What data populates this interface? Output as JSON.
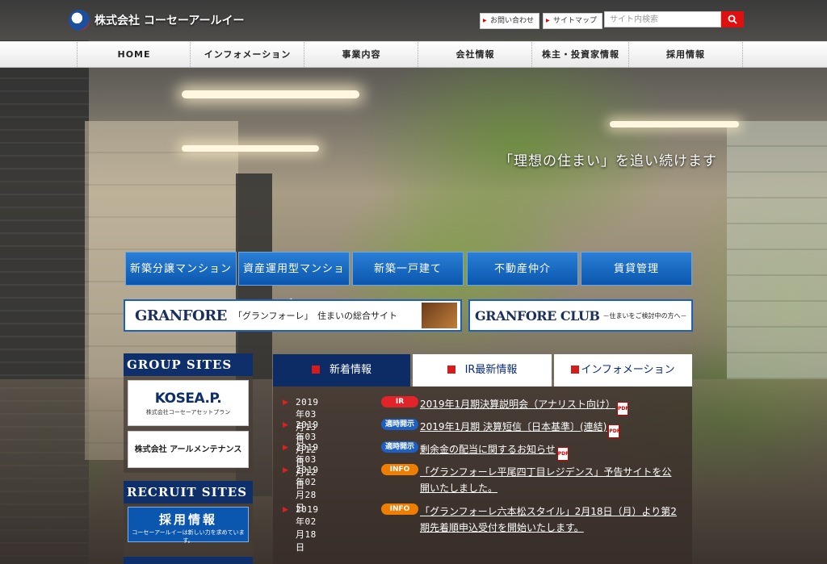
{
  "header": {
    "logo_text": "株式会社 コーセーアールイー",
    "contact_label": "お問い合わせ",
    "sitemap_label": "サイトマップ",
    "search_placeholder": "サイト内検索"
  },
  "nav": [
    "HOME",
    "インフォメーション",
    "事業内容",
    "会社情報",
    "株主・投資家情報",
    "採用情報"
  ],
  "hero": {
    "tagline": "「理想の住まい」を追い続けます"
  },
  "categories": [
    "新築分譲マンション",
    "資産運用型マンション",
    "新築一戸建て",
    "不動産仲介",
    "賃貸管理"
  ],
  "banners": {
    "granfore": {
      "brand": "GRANFORE",
      "sub": "「グランフォーレ」　住まいの総合サイト"
    },
    "club": {
      "brand": "GRANFORE CLUB",
      "sub": "－住まいをご検討中の方へ－"
    }
  },
  "sidebar": {
    "group_title": "GROUP SITES",
    "koseap_logo": "KOSEA.P.",
    "koseap_sub": "株式会社コーセーアセットプラン",
    "rmaint_name": "株式会社 アールメンテナンス",
    "recruit_title": "RECRUIT SITES",
    "recruit_main": "採用情報",
    "recruit_sub": "コーセーアールイーは新しい力を求めています。"
  },
  "tabs": [
    "新着情報",
    "IR最新情報",
    "インフォメーション"
  ],
  "news": [
    {
      "date": "2019年03月13日",
      "badge": "IR",
      "badge_type": "ir",
      "title": "2019年1月期決算説明会（アナリスト向け）",
      "pdf": true
    },
    {
      "date": "2019年03月12日",
      "badge": "適時開示",
      "badge_type": "teiji",
      "title": "2019年1月期 決算短信〔日本基準〕(連結)",
      "pdf": true
    },
    {
      "date": "2019年03月12日",
      "badge": "適時開示",
      "badge_type": "teiji",
      "title": "剰余金の配当に関するお知らせ",
      "pdf": true
    },
    {
      "date": "2019年02月28日",
      "badge": "INFO",
      "badge_type": "info",
      "title": "「グランフォーレ平尾四丁目レジデンス」予告サイトを公開いたしました。",
      "pdf": false
    },
    {
      "date": "2019年02月18日",
      "badge": "INFO",
      "badge_type": "info",
      "title": "「グランフォーレ六本松スタイル」2月18日（月）より第2期先着順申込受付を開始いたします。",
      "pdf": false
    }
  ],
  "pdf_label": "PDF",
  "colors": {
    "accent_red": "#e01010",
    "nav_blue": "#0b56ae",
    "dark_navy": "#0d2c66"
  }
}
